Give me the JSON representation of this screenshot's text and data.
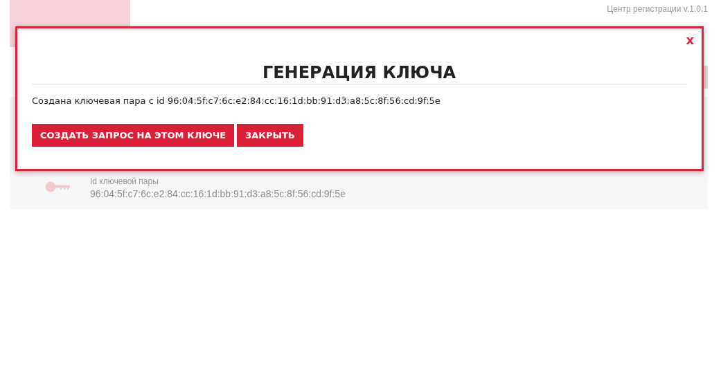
{
  "header": {
    "version": "Центр регистрации v.1.0.1"
  },
  "key_panel": {
    "label": "Id ключевой пары",
    "value": "96:04:5f:c7:6c:e2:84:cc:16:1d:bb:91:d3:a8:5c:8f:56:cd:9f:5e"
  },
  "dialog": {
    "close": "x",
    "title": "ГЕНЕРАЦИЯ КЛЮЧА",
    "message": "Создана ключевая пара с id 96:04:5f:c7:6c:e2:84:cc:16:1d:bb:91:d3:a8:5c:8f:56:cd:9f:5e",
    "buttons": [
      "СОЗДАТЬ ЗАПРОС НА ЭТОМ КЛЮЧЕ",
      "ЗАКРЫТЬ"
    ]
  }
}
